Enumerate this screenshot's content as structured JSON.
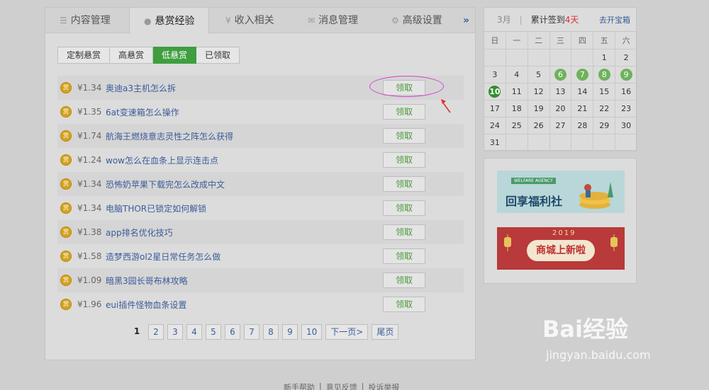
{
  "tabs": [
    {
      "label": "内容管理",
      "icon": "list-icon"
    },
    {
      "label": "悬赏经验",
      "icon": "coin-icon",
      "active": true
    },
    {
      "label": "收入相关",
      "icon": "yen-icon"
    },
    {
      "label": "消息管理",
      "icon": "mail-icon"
    },
    {
      "label": "高级设置",
      "icon": "gear-icon"
    }
  ],
  "tab_more": "»",
  "subtabs": [
    "定制悬赏",
    "高悬赏",
    "低悬赏",
    "已领取"
  ],
  "active_subtab": "低悬赏",
  "coin_label": "赏",
  "claim_label": "领取",
  "tasks": [
    {
      "price": "¥1.34",
      "title": "奥迪a3主机怎么拆"
    },
    {
      "price": "¥1.35",
      "title": "6at变速箱怎么操作"
    },
    {
      "price": "¥1.74",
      "title": "航海王燃烧意志灵性之阵怎么获得"
    },
    {
      "price": "¥1.24",
      "title": "wow怎么在血条上显示连击点"
    },
    {
      "price": "¥1.34",
      "title": "恐怖奶苹果下载完怎么改成中文"
    },
    {
      "price": "¥1.34",
      "title": "电脑THOR已锁定如何解锁"
    },
    {
      "price": "¥1.38",
      "title": "app排名优化技巧"
    },
    {
      "price": "¥1.58",
      "title": "造梦西游ol2星日常任务怎么做"
    },
    {
      "price": "¥1.09",
      "title": "暗黑3园长哥布林攻略"
    },
    {
      "price": "¥1.96",
      "title": "eui插件怪物血条设置"
    }
  ],
  "pager": {
    "pages": [
      "1",
      "2",
      "3",
      "4",
      "5",
      "6",
      "7",
      "8",
      "9",
      "10"
    ],
    "current": "1",
    "next": "下一页>",
    "last": "尾页"
  },
  "calendar": {
    "month": "3月",
    "total_label": "累计签到",
    "total_days": "4天",
    "link": "去开宝箱",
    "weekdays": [
      "日",
      "一",
      "二",
      "三",
      "四",
      "五",
      "六"
    ],
    "weeks": [
      [
        "",
        "",
        "",
        "",
        "",
        "1",
        "2"
      ],
      [
        "3",
        "4",
        "5",
        "6",
        "7",
        "8",
        "9"
      ],
      [
        "10",
        "11",
        "12",
        "13",
        "14",
        "15",
        "16"
      ],
      [
        "17",
        "18",
        "19",
        "20",
        "21",
        "22",
        "23"
      ],
      [
        "24",
        "25",
        "26",
        "27",
        "28",
        "29",
        "30"
      ],
      [
        "31",
        "",
        "",
        "",
        "",
        "",
        ""
      ]
    ],
    "signed": [
      "6",
      "7",
      "8",
      "9"
    ],
    "today": "10"
  },
  "ads": {
    "ad1_tag": "WELFARE AGENCY",
    "ad1_text": "回享福利社",
    "ad2_year": "2019",
    "ad2_text": "商城上新啦"
  },
  "footer": [
    "新手帮助",
    "|",
    "意见反馈",
    "|",
    "投诉举报"
  ],
  "watermark": {
    "brand": "Bai经验",
    "url": "jingyan.baidu.com"
  },
  "colors": {
    "accent_green": "#3f9e3f",
    "link_blue": "#3a5c9a",
    "highlight_magenta": "#d63fd6",
    "alert_red": "#e03030"
  }
}
